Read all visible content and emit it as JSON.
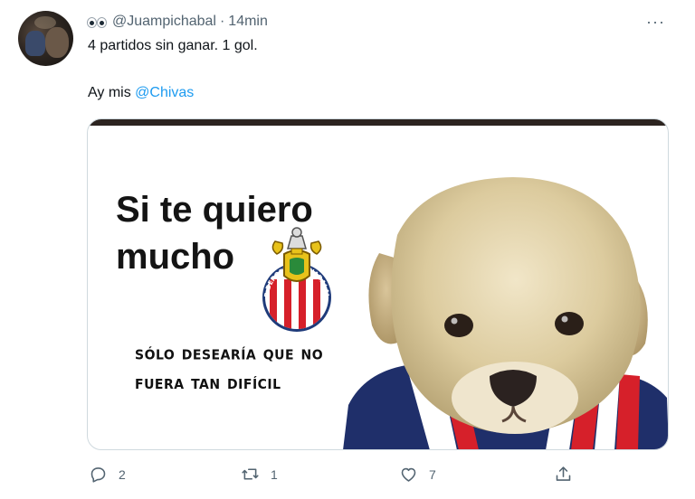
{
  "tweet": {
    "username": "@Juampichabal",
    "separator": "·",
    "time": "14min",
    "line1": "4 partidos sin ganar. 1 gol.",
    "line2_prefix": "Ay mis ",
    "mention": "@Chivas"
  },
  "icons": {
    "header": "eyes-icon",
    "more": "more-icon",
    "reply": "reply-icon",
    "retweet": "retweet-icon",
    "like": "heart-icon",
    "share": "share-icon"
  },
  "meme": {
    "title": "Si te quiero\nmucho",
    "subtitle": "sólo desearía que no\nfuera tan difícil",
    "crest_text": "CLUB DEPORTIVO GUADALAJARA"
  },
  "actions": {
    "more_glyph": "···",
    "replies": "2",
    "retweets": "1",
    "likes": "7",
    "share": ""
  },
  "colors": {
    "accent": "#1d9bf0",
    "secondary_text": "#536471",
    "primary_text": "#0f1419",
    "border": "#cfd9de"
  }
}
